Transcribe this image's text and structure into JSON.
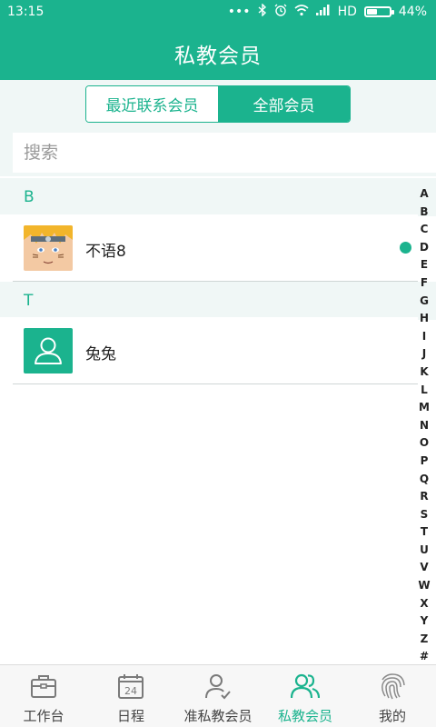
{
  "status_bar": {
    "time": "13:15",
    "dots": "•••",
    "network": "HD",
    "battery_percent_label": "44%",
    "battery_level": 0.44
  },
  "header": {
    "title": "私教会员"
  },
  "tabs": [
    {
      "label": "最近联系会员",
      "active": false
    },
    {
      "label": "全部会员",
      "active": true
    }
  ],
  "search": {
    "placeholder": "搜索",
    "value": ""
  },
  "sections": [
    {
      "letter": "B",
      "members": [
        {
          "name": "不语8",
          "avatar": "photo",
          "online": true
        }
      ]
    },
    {
      "letter": "T",
      "members": [
        {
          "name": "兔兔",
          "avatar": "default-person-icon",
          "online": false
        }
      ]
    }
  ],
  "alphabet_index": [
    "A",
    "B",
    "C",
    "D",
    "E",
    "F",
    "G",
    "H",
    "I",
    "J",
    "K",
    "L",
    "M",
    "N",
    "O",
    "P",
    "Q",
    "R",
    "S",
    "T",
    "U",
    "V",
    "W",
    "X",
    "Y",
    "Z",
    "#"
  ],
  "bottom_nav": [
    {
      "label": "工作台",
      "icon": "briefcase-icon",
      "active": false
    },
    {
      "label": "日程",
      "icon": "calendar-icon",
      "icon_text": "24",
      "active": false
    },
    {
      "label": "准私教会员",
      "icon": "user-check-icon",
      "active": false
    },
    {
      "label": "私教会员",
      "icon": "users-icon",
      "active": true
    },
    {
      "label": "我的",
      "icon": "fingerprint-icon",
      "active": false
    }
  ],
  "colors": {
    "accent": "#1bb38e",
    "section_bg": "#f0f7f6",
    "nav_bg": "#f7f7f7"
  }
}
